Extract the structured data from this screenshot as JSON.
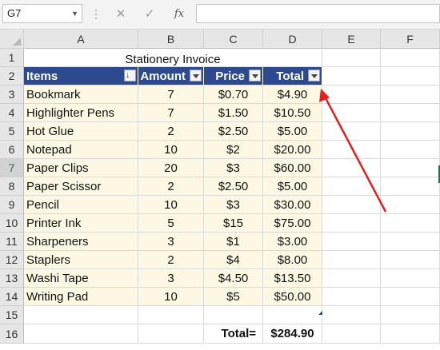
{
  "formula_bar": {
    "name_box": "G7",
    "cancel_icon": "✕",
    "enter_icon": "✓",
    "fx_label": "fx",
    "formula": ""
  },
  "columns": [
    "A",
    "B",
    "C",
    "D",
    "E",
    "F"
  ],
  "rows": [
    "1",
    "2",
    "3",
    "4",
    "5",
    "6",
    "7",
    "8",
    "9",
    "10",
    "11",
    "12",
    "13",
    "14",
    "15",
    "16"
  ],
  "title": "Stationery Invoice",
  "table": {
    "headers": [
      "Items",
      "Amount",
      "Price",
      "Total"
    ],
    "rows": [
      {
        "item": "Bookmark",
        "amount": "7",
        "price": "$0.70",
        "total": "$4.90"
      },
      {
        "item": "Highlighter Pens",
        "amount": "7",
        "price": "$1.50",
        "total": "$10.50"
      },
      {
        "item": "Hot Glue",
        "amount": "2",
        "price": "$2.50",
        "total": "$5.00"
      },
      {
        "item": "Notepad",
        "amount": "10",
        "price": "$2",
        "total": "$20.00"
      },
      {
        "item": "Paper Clips",
        "amount": "20",
        "price": "$3",
        "total": "$60.00"
      },
      {
        "item": "Paper Scissor",
        "amount": "2",
        "price": "$2.50",
        "total": "$5.00"
      },
      {
        "item": "Pencil",
        "amount": "10",
        "price": "$3",
        "total": "$30.00"
      },
      {
        "item": "Printer Ink",
        "amount": "5",
        "price": "$15",
        "total": "$75.00"
      },
      {
        "item": "Sharpeners",
        "amount": "3",
        "price": "$1",
        "total": "$3.00"
      },
      {
        "item": "Staplers",
        "amount": "2",
        "price": "$4",
        "total": "$8.00"
      },
      {
        "item": "Washi Tape",
        "amount": "3",
        "price": "$4.50",
        "total": "$13.50"
      },
      {
        "item": "Writing Pad",
        "amount": "10",
        "price": "$5",
        "total": "$50.00"
      }
    ]
  },
  "summary": {
    "label": "Total=",
    "value": "$284.90"
  },
  "colors": {
    "header_fill": "#2e4a8f",
    "band_fill": "#fdf8e4",
    "annotation_arrow": "#e02020",
    "selection": "#217346"
  }
}
